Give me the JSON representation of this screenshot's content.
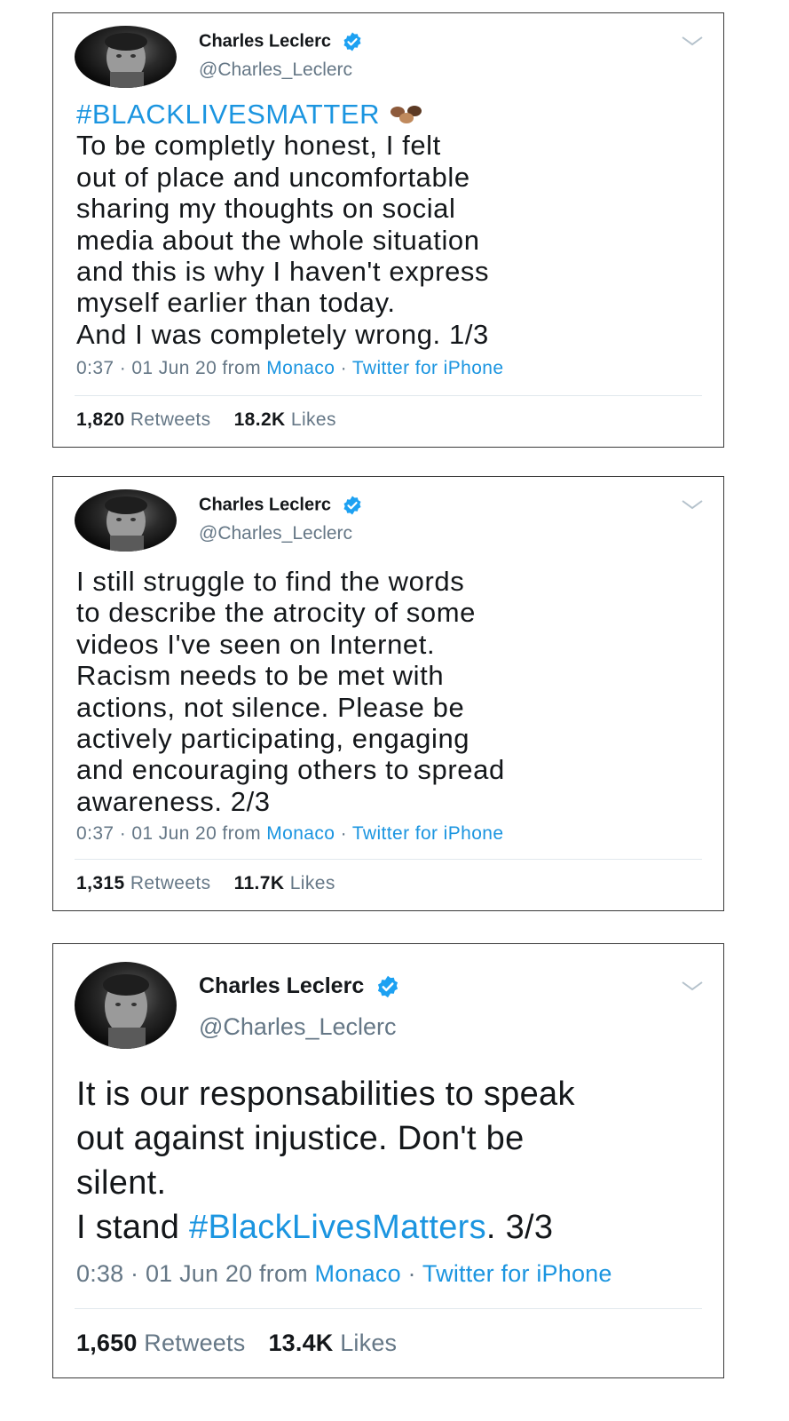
{
  "colors": {
    "link": "#1b95e0",
    "text": "#14171a",
    "muted": "#657786",
    "verified": "#1da1f2"
  },
  "tweets": [
    {
      "author_name": "Charles Leclerc",
      "handle": "@Charles_Leclerc",
      "hashtag_line": "#BLACKLIVESMATTER",
      "emoji": "fist-emoji-icons",
      "text": "To be completly honest, I felt\nout of place and uncomfortable\nsharing my thoughts on social\nmedia about the whole situation\nand this is why I haven't express\nmyself earlier than today.\nAnd I was completely wrong. 1/3",
      "time": "0:37 · 01 Jun 20 from ",
      "location": "Monaco",
      "sep": " · ",
      "source": "Twitter for iPhone",
      "retweets_count": "1,820",
      "retweets_label": "Retweets",
      "likes_count": "18.2K",
      "likes_label": "Likes"
    },
    {
      "author_name": "Charles Leclerc",
      "handle": "@Charles_Leclerc",
      "text": "I still struggle to find the words\nto describe the atrocity of some\nvideos I've seen on Internet.\nRacism needs to be met with\nactions, not silence. Please be\nactively participating, engaging\nand encouraging others to spread\nawareness. 2/3",
      "time": "0:37 · 01 Jun 20 from ",
      "location": "Monaco",
      "sep": " · ",
      "source": "Twitter for iPhone",
      "retweets_count": "1,315",
      "retweets_label": "Retweets",
      "likes_count": "11.7K",
      "likes_label": "Likes"
    },
    {
      "author_name": "Charles Leclerc",
      "handle": "@Charles_Leclerc",
      "text_part1": "It is our responsabilities to speak\nout against injustice. Don't be\nsilent.\nI stand ",
      "hashtag": "#BlackLivesMatters",
      "text_part2": ". 3/3",
      "time": "0:38 · 01 Jun 20 from ",
      "location": "Monaco",
      "sep": " · ",
      "source": "Twitter for iPhone",
      "retweets_count": "1,650",
      "retweets_label": "Retweets",
      "likes_count": "13.4K",
      "likes_label": "Likes"
    }
  ]
}
